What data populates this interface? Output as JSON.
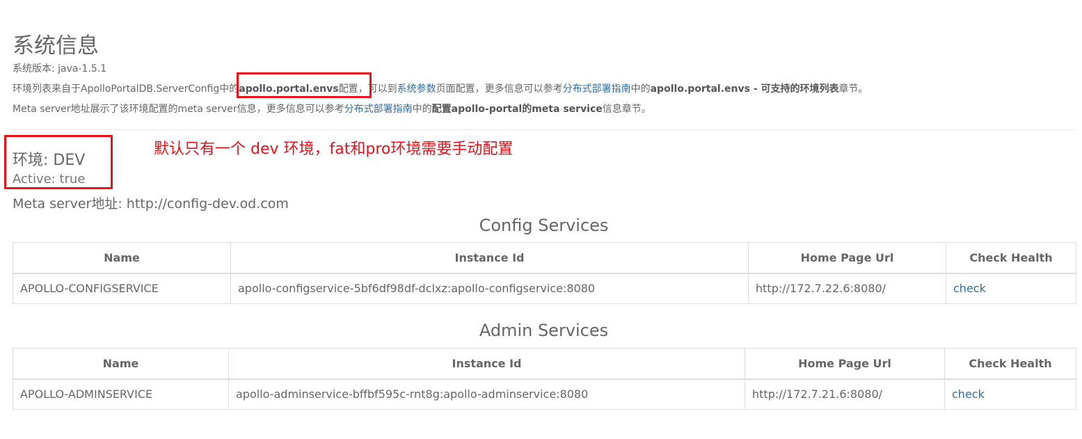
{
  "header": {
    "title": "系统信息",
    "version": "系统版本: java-1.5.1",
    "envs_line": {
      "prefix": "环境列表来自于ApolloPortalDB.ServerConfig中的",
      "key_bold": "apollo.portal.envs",
      "mid1": "配置，可以到",
      "link_sysparams": "系统参数",
      "mid2": "页面配置，更多信息可以参考",
      "link_guide": "分布式部署指南",
      "mid3": "中的",
      "bold_section": "apollo.portal.envs - 可支持的环境列表",
      "suffix": "章节。"
    },
    "meta_line": {
      "prefix": "Meta server地址展示了该环境配置的meta server信息，更多信息可以参考",
      "link_guide": "分布式部署指南",
      "mid": "中的",
      "bold_section": "配置apollo-portal的meta service",
      "suffix": "信息章节。"
    }
  },
  "annotation": {
    "text": "默认只有一个 dev 环境，fat和pro环境需要手动配置",
    "color": "#e8131a"
  },
  "env": {
    "label": "环境: DEV",
    "active": "Active: true",
    "meta_server": "Meta server地址: http://config-dev.od.com"
  },
  "config_services": {
    "title": "Config Services",
    "headers": [
      "Name",
      "Instance Id",
      "Home Page Url",
      "Check Health"
    ],
    "rows": [
      {
        "name": "APOLLO-CONFIGSERVICE",
        "instance_id": "apollo-configservice-5bf6df98df-dclxz:apollo-configservice:8080",
        "home_page_url": "http://172.7.22.6:8080/",
        "check": "check"
      }
    ]
  },
  "admin_services": {
    "title": "Admin Services",
    "headers": [
      "Name",
      "Instance Id",
      "Home Page Url",
      "Check Health"
    ],
    "rows": [
      {
        "name": "APOLLO-ADMINSERVICE",
        "instance_id": "apollo-adminservice-bffbf595c-rnt8g:apollo-adminservice:8080",
        "home_page_url": "http://172.7.21.6:8080/",
        "check": "check"
      }
    ]
  },
  "colors": {
    "link": "#2f6ea5",
    "annotation": "#e8131a",
    "text": "#666666"
  }
}
